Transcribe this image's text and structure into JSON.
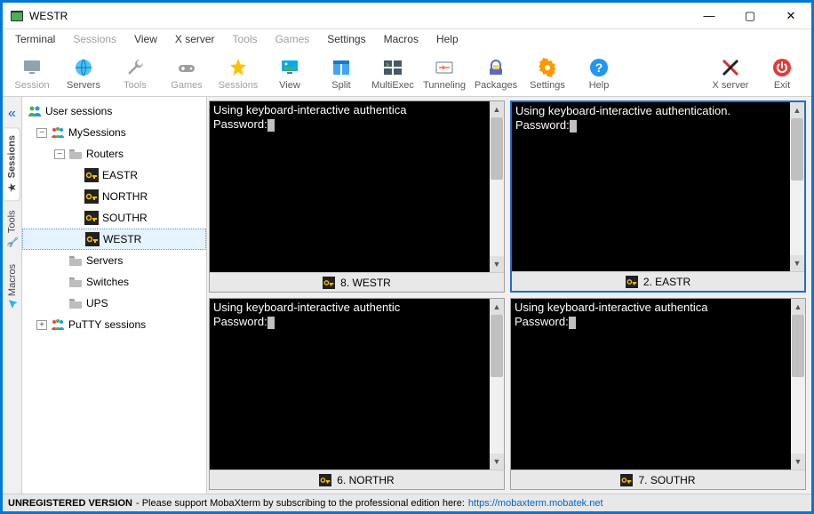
{
  "window": {
    "title": "WESTR"
  },
  "menu": {
    "terminal": "Terminal",
    "sessions": "Sessions",
    "view": "View",
    "xserver": "X server",
    "tools": "Tools",
    "games": "Games",
    "settings": "Settings",
    "macros": "Macros",
    "help": "Help"
  },
  "toolbar": {
    "session": "Session",
    "servers": "Servers",
    "tools": "Tools",
    "games": "Games",
    "sessions": "Sessions",
    "view": "View",
    "split": "Split",
    "multiexec": "MultiExec",
    "tunneling": "Tunneling",
    "packages": "Packages",
    "settings": "Settings",
    "help": "Help",
    "xserver": "X server",
    "exit": "Exit"
  },
  "sidetabs": {
    "sessions": "Sessions",
    "tools": "Tools",
    "macros": "Macros"
  },
  "tree": {
    "user_sessions": "User sessions",
    "my_sessions": "MySessions",
    "routers": "Routers",
    "eastr": "EASTR",
    "northr": "NORTHR",
    "southr": "SOUTHR",
    "westr": "WESTR",
    "servers": "Servers",
    "switches": "Switches",
    "ups": "UPS",
    "putty": "PuTTY sessions"
  },
  "terminals": {
    "t0": {
      "label": "8. WESTR",
      "text": "Using keyboard-interactive authentica\nPassword:"
    },
    "t1": {
      "label": "2. EASTR",
      "text": "Using keyboard-interactive authentication.\nPassword:"
    },
    "t2": {
      "label": "6. NORTHR",
      "text": "Using keyboard-interactive authentic\nPassword:"
    },
    "t3": {
      "label": "7. SOUTHR",
      "text": "Using keyboard-interactive authentica\nPassword:"
    }
  },
  "status": {
    "unreg": "UNREGISTERED VERSION",
    "msg": " -  Please support MobaXterm by subscribing to the professional edition here:  ",
    "link": "https://mobaxterm.mobatek.net"
  }
}
